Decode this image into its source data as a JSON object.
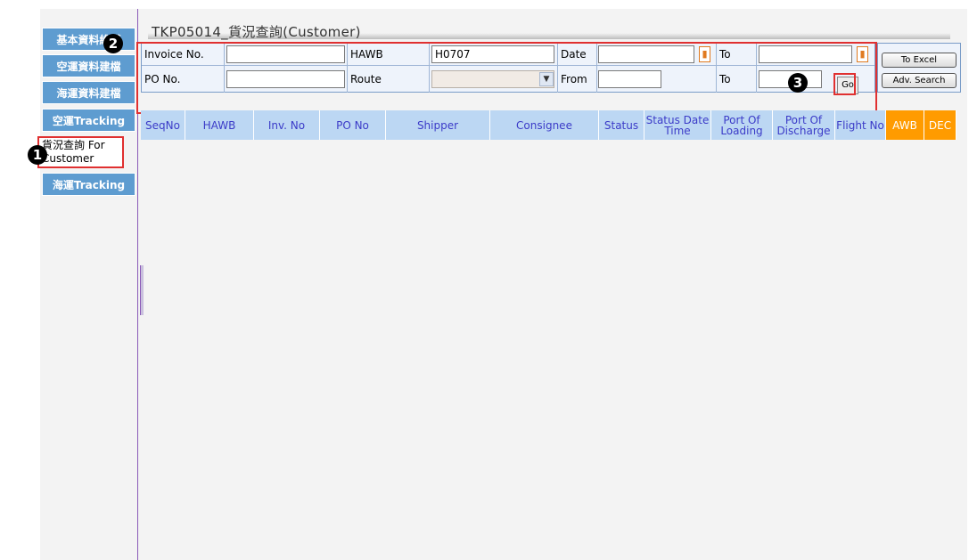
{
  "sidebar": {
    "items": [
      {
        "label": "基本資料維護"
      },
      {
        "label": "空運資料建檔"
      },
      {
        "label": "海運資料建檔"
      },
      {
        "label": "空運Tracking"
      },
      {
        "label": "貨況查詢 For Customer"
      },
      {
        "label": "海運Tracking"
      }
    ]
  },
  "page": {
    "title": "TKP05014_貨況查詢(Customer)"
  },
  "form": {
    "invoice_label": "Invoice No.",
    "invoice_value": "",
    "hawb_label": "HAWB",
    "hawb_value": "H0707",
    "date_label": "Date",
    "date_value": "",
    "to_label_1": "To",
    "to_value_1": "",
    "po_label": "PO No.",
    "po_value": "",
    "route_label": "Route",
    "route_value": "",
    "from_label": "From",
    "from_value": "",
    "to_label_2": "To",
    "to_value_2": "",
    "go_label": "Go"
  },
  "actions": {
    "to_excel": "To Excel",
    "adv_search": "Adv. Search"
  },
  "table": {
    "columns": [
      {
        "label": "SeqNo"
      },
      {
        "label": "HAWB"
      },
      {
        "label": "Inv. No"
      },
      {
        "label": "PO No"
      },
      {
        "label": "Shipper"
      },
      {
        "label": "Consignee"
      },
      {
        "label": "Status"
      },
      {
        "label": "Status Date Time"
      },
      {
        "label": "Port Of Loading"
      },
      {
        "label": "Port Of Discharge"
      },
      {
        "label": "Flight No"
      },
      {
        "label": "AWB"
      },
      {
        "label": "DEC"
      }
    ]
  },
  "markers": {
    "m1": "1",
    "m2": "2",
    "m3": "3"
  },
  "colors": {
    "sidebar": "#5e9cd0",
    "header": "#bcd7f3",
    "accent": "#ff9b00",
    "highlight": "#e03030"
  }
}
